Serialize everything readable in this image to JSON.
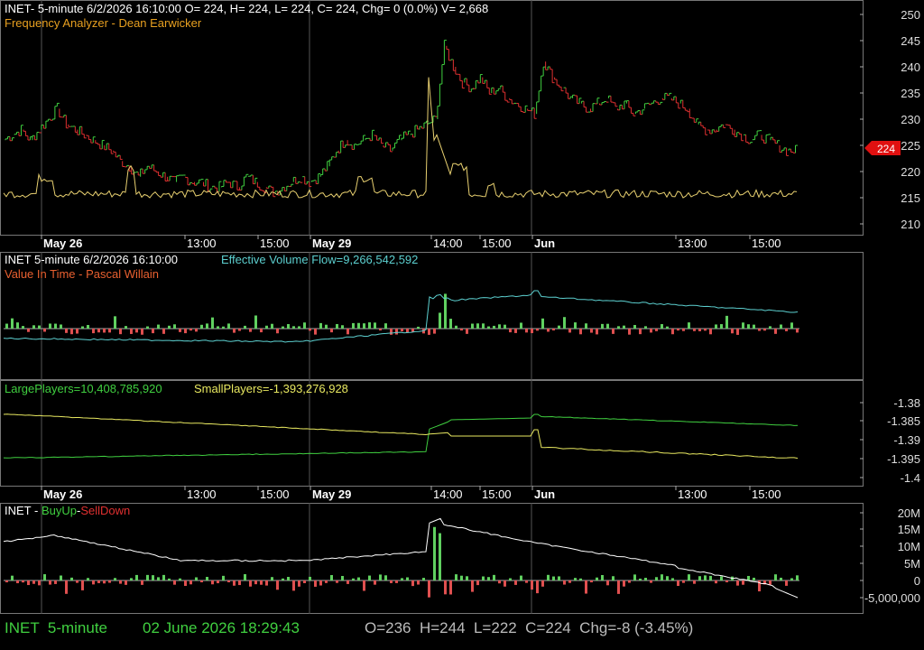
{
  "colors": {
    "up": "#40d040",
    "down": "#e03030",
    "freq": "#e8d070",
    "evf": "#5ccfcf",
    "large": "#40d040",
    "small": "#e8e860",
    "vol_up": "#60d060",
    "vol_down": "#e05050",
    "grid": "#555555",
    "price_tag": "#e01010"
  },
  "panel1": {
    "header": "INET- 5-minute 6/2/2026 16:10:00 O= 224, H= 224, L= 224, C= 224, Chg= 0 (0.0%) V= 2,668",
    "indicator": "Frequency Analyzer - Dean Earwicker",
    "y_ticks": [
      "250",
      "245",
      "240",
      "235",
      "230",
      "225",
      "220",
      "215",
      "210"
    ],
    "price_tag": "224"
  },
  "panel2": {
    "header_ticker": "INET 5-minute  6/2/2026 16:10:00",
    "header_evf": "Effective Volume Flow=9,266,542,592",
    "indicator": "Value In Time - Pascal Willain"
  },
  "panel3": {
    "large_label": "LargePlayers=10,408,785,920",
    "small_label": "SmallPlayers=-1,393,276,928",
    "y_ticks": [
      "-1.38",
      "-1.385",
      "-1.39",
      "-1.395",
      "-1.4"
    ]
  },
  "panel4": {
    "label_ticker": "INET - ",
    "label_buy": "BuyUp",
    "label_sep": "-",
    "label_sell": "SellDown",
    "y_ticks": [
      "20M",
      "15M",
      "10M",
      "5M",
      "0",
      "-5,000,000"
    ]
  },
  "x_axis_labels": [
    {
      "text": "May 26",
      "bold": true
    },
    {
      "text": "13:00",
      "bold": false
    },
    {
      "text": "15:00",
      "bold": false
    },
    {
      "text": "May 29",
      "bold": true
    },
    {
      "text": "14:00",
      "bold": false
    },
    {
      "text": "15:00",
      "bold": false
    },
    {
      "text": "Jun",
      "bold": true
    },
    {
      "text": "13:00",
      "bold": false
    },
    {
      "text": "15:00",
      "bold": false
    }
  ],
  "status_bar": {
    "ticker": "INET  5-minute",
    "datetime": "02 June 2026 18:29:43",
    "ohlc": "O=236  H=244  L=222  C=224  Chg=-8 (-3.45%)"
  },
  "chart_data": {
    "type": "line",
    "price_ohlc_close_path": [
      226,
      227,
      228,
      226,
      228,
      230,
      232,
      229,
      228,
      227,
      226,
      225,
      224,
      222,
      221,
      219,
      221,
      220,
      219,
      218,
      219,
      218,
      218,
      217,
      217,
      218,
      217,
      219,
      218,
      217,
      216,
      217,
      218,
      219,
      218,
      219,
      221,
      224,
      226,
      225,
      226,
      227,
      225,
      224,
      226,
      227,
      228,
      229,
      230,
      244,
      240,
      237,
      236,
      238,
      235,
      236,
      234,
      233,
      232,
      231,
      241,
      238,
      236,
      234,
      233,
      232,
      233,
      234,
      232,
      233,
      231,
      232,
      233,
      234,
      234,
      233,
      232,
      229,
      228,
      228,
      229,
      228,
      227,
      226,
      227,
      226,
      225,
      224,
      224
    ],
    "price_ylim": [
      208,
      252
    ]
  }
}
